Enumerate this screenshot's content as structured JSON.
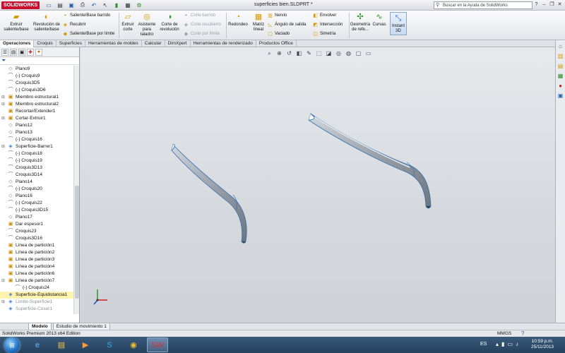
{
  "window": {
    "app_logo": "SOLIDWORKS",
    "doc_title": "superficies bien.SLDPRT *",
    "help_search_placeholder": "Buscar en la Ayuda de SolidWorks"
  },
  "quick_access": [
    "new-icon",
    "open-icon",
    "save-icon",
    "print-icon",
    "undo-icon",
    "select-icon",
    "rebuild-icon",
    "file-properties-icon",
    "options-icon"
  ],
  "ribbon": {
    "extrude_boss": "Extruir saliente/base",
    "revolve_boss": "Revolución de saliente/base",
    "swept_boss": "Saliente/Base barrido",
    "loft": "Recubrir",
    "boundary_boss": "Saliente/Base por límite",
    "extrude_cut": "Extruir corte",
    "hole_wizard": "Asistente para taladro",
    "revolve_cut": "Corte de revolución",
    "swept_cut": "Corte barrido",
    "lofted_cut": "Corte recubierto",
    "boundary_cut": "Corte por límite",
    "fillet": "Redondeo",
    "linear_pattern": "Matriz lineal",
    "rib": "Nervio",
    "draft": "Ángulo de salida",
    "shell": "Vaciado",
    "wrap": "Envolver",
    "intersect": "Intersección",
    "mirror": "Simetría",
    "reference_geometry": "Geometría de refe...",
    "curves": "Curvas",
    "instant3d": "Instant 3D"
  },
  "tabs": [
    "Operaciones",
    "Croquis",
    "Superficies",
    "Herramientas de moldes",
    "Calcular",
    "DimXpert",
    "Herramientas de renderizado",
    "Productos Office"
  ],
  "active_tab": "Operaciones",
  "tree": [
    {
      "label": "Plano9",
      "icon": "plane-icon",
      "kind": "plane"
    },
    {
      "label": "(-) Croquis9",
      "icon": "sketch-icon",
      "kind": "sketch"
    },
    {
      "label": "Croquis3D5",
      "icon": "sketch3d-icon",
      "kind": "sketch"
    },
    {
      "label": "(-) Croquis3D6",
      "icon": "sketch3d-icon",
      "kind": "sketch"
    },
    {
      "label": "Miembro estructural1",
      "icon": "weldment-icon",
      "kind": "feat",
      "exp": true
    },
    {
      "label": "Miembro estructural2",
      "icon": "weldment-icon",
      "kind": "feat",
      "exp": true
    },
    {
      "label": "Recortar/Extender1",
      "icon": "trim-extend-icon",
      "kind": "feat"
    },
    {
      "label": "Cortar-Extruir1",
      "icon": "cut-extrude-icon",
      "kind": "feat",
      "exp": true
    },
    {
      "label": "Plano12",
      "icon": "plane-icon",
      "kind": "plane"
    },
    {
      "label": "Plano13",
      "icon": "plane-icon",
      "kind": "plane"
    },
    {
      "label": "(-) Croquis16",
      "icon": "sketch-icon",
      "kind": "sketch"
    },
    {
      "label": "Superficie-Barrer1",
      "icon": "surface-sweep-icon",
      "kind": "surf",
      "exp": true
    },
    {
      "label": "(-) Croquis18",
      "icon": "sketch-icon",
      "kind": "sketch"
    },
    {
      "label": "(-) Croquis19",
      "icon": "sketch-icon",
      "kind": "sketch"
    },
    {
      "label": "Croquis3D13",
      "icon": "sketch3d-icon",
      "kind": "sketch"
    },
    {
      "label": "Croquis3D14",
      "icon": "sketch3d-icon",
      "kind": "sketch"
    },
    {
      "label": "Plano14",
      "icon": "plane-icon",
      "kind": "plane"
    },
    {
      "label": "(-) Croquis20",
      "icon": "sketch-icon",
      "kind": "sketch"
    },
    {
      "label": "Plano16",
      "icon": "plane-icon",
      "kind": "plane"
    },
    {
      "label": "(-) Croquis22",
      "icon": "sketch-icon",
      "kind": "sketch"
    },
    {
      "label": "(-) Croquis3D15",
      "icon": "sketch3d-icon",
      "kind": "sketch"
    },
    {
      "label": "Plano17",
      "icon": "plane-icon",
      "kind": "plane"
    },
    {
      "label": "Dar espesor1",
      "icon": "thicken-icon",
      "kind": "feat"
    },
    {
      "label": "Croquis23",
      "icon": "sketch-icon",
      "kind": "sketch"
    },
    {
      "label": "Croquis3D16",
      "icon": "sketch3d-icon",
      "kind": "sketch"
    },
    {
      "label": "Línea de partición1",
      "icon": "split-line-icon",
      "kind": "feat"
    },
    {
      "label": "Línea de partición2",
      "icon": "split-line-icon",
      "kind": "feat"
    },
    {
      "label": "Línea de partición3",
      "icon": "split-line-icon",
      "kind": "feat"
    },
    {
      "label": "Línea de partición4",
      "icon": "split-line-icon",
      "kind": "feat"
    },
    {
      "label": "Línea de partición6",
      "icon": "split-line-icon",
      "kind": "feat"
    },
    {
      "label": "Línea de partición7",
      "icon": "split-line-icon",
      "kind": "feat",
      "exp": true
    },
    {
      "label": "(-) Croquis24",
      "icon": "sketch-icon",
      "kind": "sketch",
      "sub": true
    },
    {
      "label": "Superficie-Equidistancia1",
      "icon": "surface-offset-icon",
      "kind": "surf",
      "selected": true
    },
    {
      "label": "Límite-Superficie1",
      "icon": "boundary-surface-icon",
      "kind": "surf",
      "suppressed": true,
      "exp": true
    },
    {
      "label": "Superficie-Coser1",
      "icon": "knit-surface-icon",
      "kind": "surf",
      "suppressed": true
    }
  ],
  "bottom_tabs": [
    "Modelo",
    "Estudio de movimiento 1"
  ],
  "active_bottom_tab": "Modelo",
  "status": {
    "left": "SolidWorks Premium 2013 x64 Edition",
    "units": "MMGS"
  },
  "taskbar": {
    "lang": "ES",
    "time": "10:59 p.m.",
    "date": "25/11/2013",
    "apps": [
      "ie-icon",
      "explorer-icon",
      "media-player-icon",
      "skype-icon",
      "chrome-icon",
      "solidworks-icon"
    ]
  }
}
